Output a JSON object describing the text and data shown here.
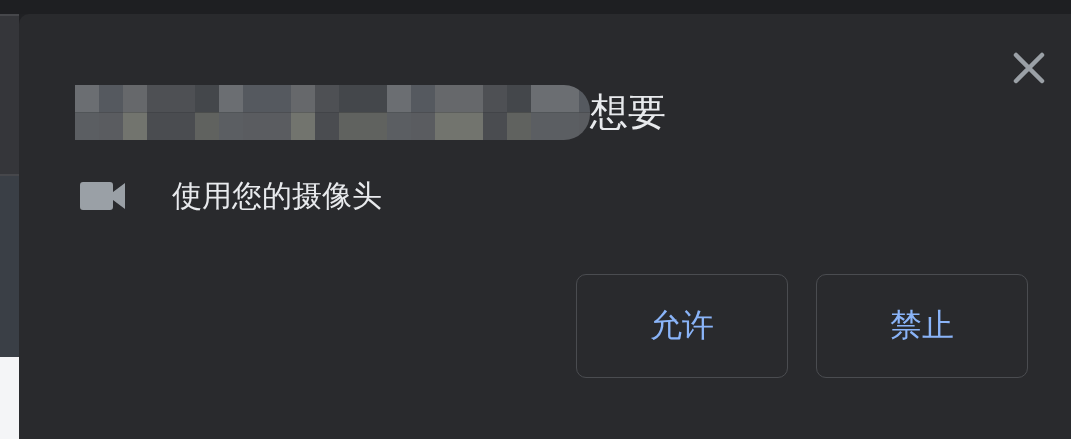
{
  "dialog": {
    "title": "想要",
    "permission": {
      "text": "使用您的摄像头"
    },
    "buttons": [
      {
        "label": "允许"
      },
      {
        "label": "禁止"
      }
    ]
  }
}
